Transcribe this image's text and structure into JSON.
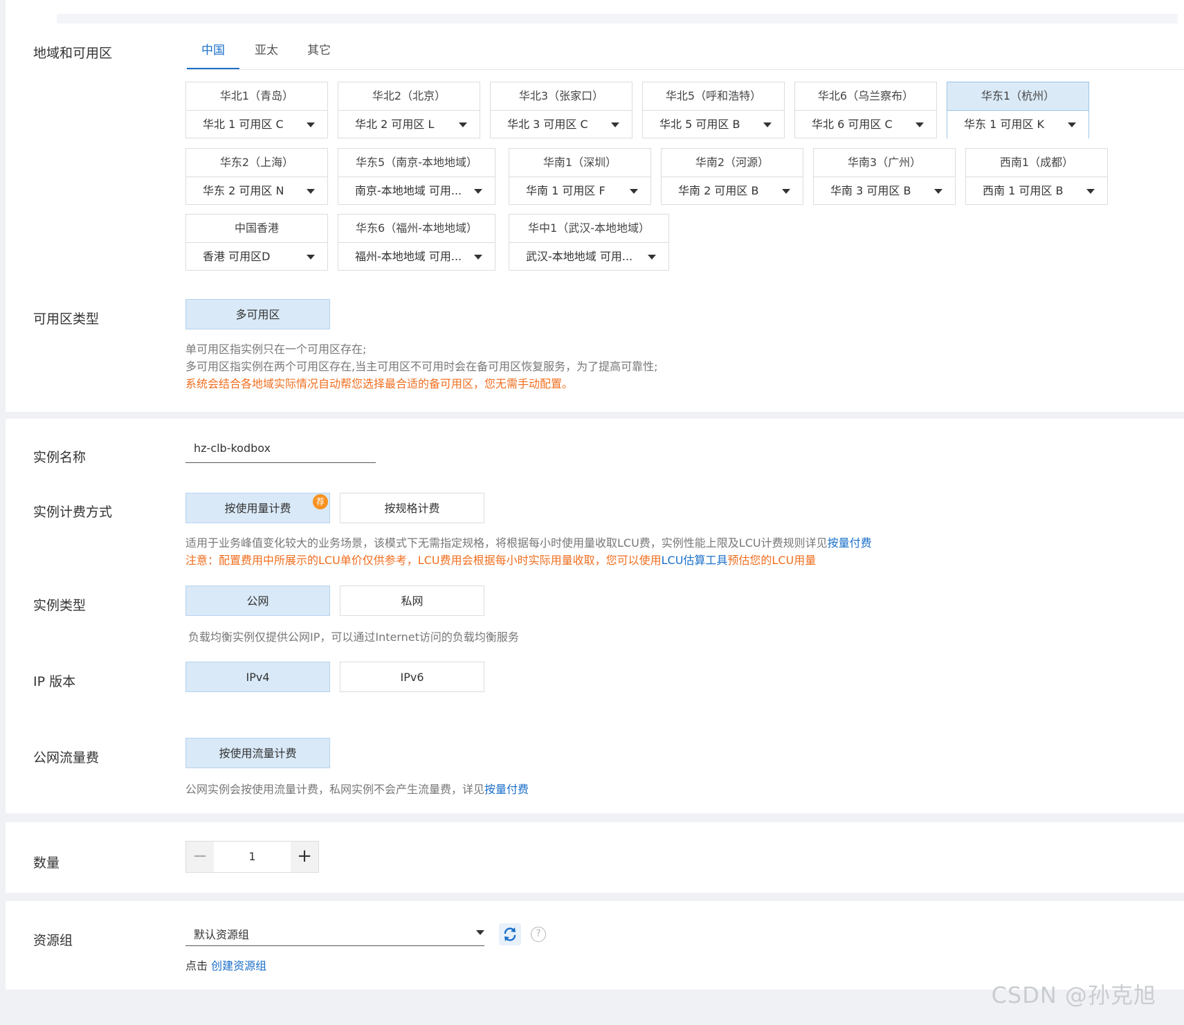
{
  "region": {
    "label": "地域和可用区",
    "tabs": [
      "中国",
      "亚太",
      "其它"
    ],
    "active_tab": 0,
    "cards": [
      {
        "name": "华北1（青岛）",
        "zone": "华北 1 可用区 C"
      },
      {
        "name": "华北2（北京）",
        "zone": "华北 2 可用区 L"
      },
      {
        "name": "华北3（张家口）",
        "zone": "华北 3 可用区 C"
      },
      {
        "name": "华北5（呼和浩特）",
        "zone": "华北 5 可用区 B"
      },
      {
        "name": "华北6（乌兰察布）",
        "zone": "华北 6 可用区 C"
      },
      {
        "name": "华东1（杭州）",
        "zone": "华东 1 可用区 K",
        "selected": true
      },
      {
        "name": "华东2（上海）",
        "zone": "华东 2 可用区 N"
      },
      {
        "name": "华东5（南京-本地地域）",
        "zone": "南京-本地地域 可用..."
      },
      {
        "name": "华南1（深圳）",
        "zone": "华南 1 可用区 F"
      },
      {
        "name": "华南2（河源）",
        "zone": "华南 2 可用区 B"
      },
      {
        "name": "华南3（广州）",
        "zone": "华南 3 可用区 B"
      },
      {
        "name": "西南1（成都）",
        "zone": "西南 1 可用区 B"
      },
      {
        "name": "中国香港",
        "zone": "香港 可用区D"
      },
      {
        "name": "华东6（福州-本地地域）",
        "zone": "福州-本地地域 可用..."
      },
      {
        "name": "华中1（武汉-本地地域）",
        "zone": "武汉-本地地域 可用..."
      }
    ]
  },
  "zone_type": {
    "label": "可用区类型",
    "option": "多可用区",
    "hint1": "单可用区指实例只在一个可用区存在;",
    "hint2": "多可用区指实例在两个可用区存在,当主可用区不可用时会在备可用区恢复服务，为了提高可靠性;",
    "hint3": "系统会结合各地域实际情况自动帮您选择最合适的备可用区，您无需手动配置。"
  },
  "instance_name": {
    "label": "实例名称",
    "value": "hz-clb-kodbox"
  },
  "billing": {
    "label": "实例计费方式",
    "options": [
      "按使用量计费",
      "按规格计费"
    ],
    "badge": "荐",
    "hint_prefix": "适用于业务峰值变化较大的业务场景，该模式下无需指定规格，将根据每小时使用量收取LCU费，实例性能上限及LCU计费规则详见",
    "hint_link": "按量付费",
    "warn_prefix": "注意：配置费用中所展示的LCU单价仅供参考，LCU费用会根据每小时实际用量收取，您可以使用",
    "warn_link": "LCU估算工具",
    "warn_suffix": "预估您的LCU用量"
  },
  "instance_type": {
    "label": "实例类型",
    "options": [
      "公网",
      "私网"
    ],
    "hint": "负载均衡实例仅提供公网IP，可以通过Internet访问的负载均衡服务"
  },
  "ip_version": {
    "label": "IP 版本",
    "options": [
      "IPv4",
      "IPv6"
    ]
  },
  "traffic": {
    "label": "公网流量费",
    "option": "按使用流量计费",
    "hint_prefix": "公网实例会按使用流量计费，私网实例不会产生流量费，详见",
    "hint_link": "按量付费"
  },
  "quantity": {
    "label": "数量",
    "minus": "−",
    "value": "1",
    "plus": "+"
  },
  "resource_group": {
    "label": "资源组",
    "value": "默认资源组",
    "hint_prefix": "点击 ",
    "hint_link": "创建资源组"
  },
  "watermark": "CSDN @孙克旭",
  "colors": {
    "accent": "#1a6fc9",
    "selected_bg": "#d9e9f7",
    "warn": "#f06e1f",
    "badge": "#f7911f"
  }
}
